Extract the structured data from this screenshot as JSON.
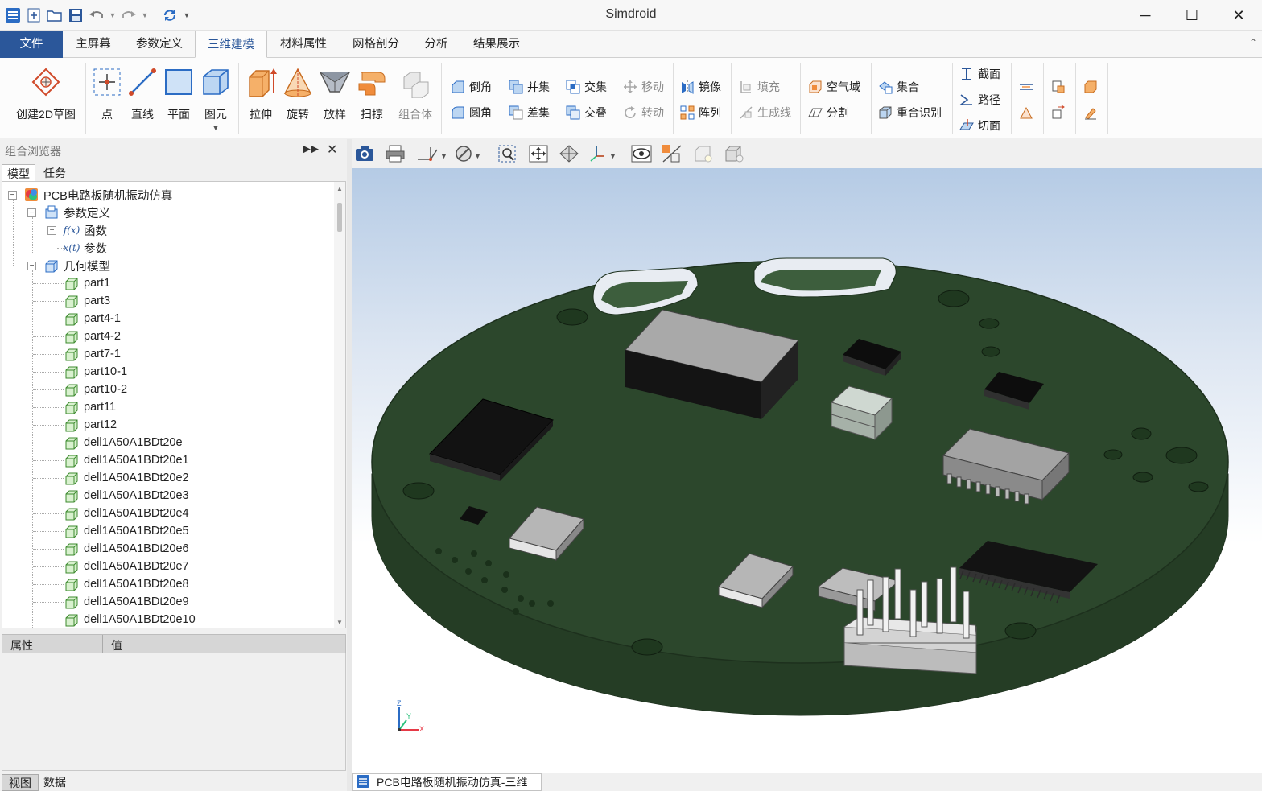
{
  "app": {
    "title": "Simdroid"
  },
  "window_controls": {
    "minimize": "─",
    "maximize": "☐",
    "close": "✕"
  },
  "ribbon_tabs": [
    "文件",
    "主屏幕",
    "参数定义",
    "三维建模",
    "材料属性",
    "网格剖分",
    "分析",
    "结果展示"
  ],
  "active_tab": "三维建模",
  "ribbon": {
    "sketch": "创建2D草图",
    "primitives": [
      "点",
      "直线",
      "平面",
      "图元"
    ],
    "features": [
      "拉伸",
      "旋转",
      "放样",
      "扫掠",
      "组合体"
    ],
    "disabled_features": [
      "组合体"
    ],
    "edit": {
      "chamfer": "倒角",
      "fillet": "圆角",
      "union": "并集",
      "subtract": "差集",
      "intersect": "交集",
      "overlap": "交叠",
      "move": "移动",
      "rotate": "转动",
      "mirror": "镜像",
      "array": "阵列",
      "fill": "填充",
      "generate_line": "生成线",
      "air_domain": "空气域",
      "split": "分割",
      "set": "集合",
      "overlap_detect": "重合识别",
      "section": "截面",
      "path": "路径",
      "cut_plane": "切面"
    },
    "disabled_edit": [
      "移动",
      "转动",
      "填充",
      "生成线"
    ]
  },
  "browser": {
    "title": "组合浏览器",
    "tabs": [
      "模型",
      "任务"
    ],
    "active_tab": "模型",
    "root": "PCB电路板随机振动仿真",
    "param_group": "参数定义",
    "param_children": [
      {
        "label": "函数",
        "icon": "function-icon"
      },
      {
        "label": "参数",
        "icon": "variable-icon"
      }
    ],
    "geom_group": "几何模型",
    "parts": [
      "part1",
      "part3",
      "part4-1",
      "part4-2",
      "part7-1",
      "part10-1",
      "part10-2",
      "part11",
      "part12",
      "dell1A50A1BDt20e",
      "dell1A50A1BDt20e1",
      "dell1A50A1BDt20e2",
      "dell1A50A1BDt20e3",
      "dell1A50A1BDt20e4",
      "dell1A50A1BDt20e5",
      "dell1A50A1BDt20e6",
      "dell1A50A1BDt20e7",
      "dell1A50A1BDt20e8",
      "dell1A50A1BDt20e9",
      "dell1A50A1BDt20e10"
    ]
  },
  "properties": {
    "col_property": "属性",
    "col_value": "值"
  },
  "bottom_tabs": [
    "视图",
    "数据"
  ],
  "bottom_active": "视图",
  "viewport": {
    "doc_tab": "PCB电路板随机振动仿真-三维",
    "axes": {
      "x": "X",
      "y": "Y",
      "z": "Z"
    },
    "toolbar_icons": [
      "camera-icon",
      "print-icon",
      "axis-view-icon",
      "no-section-icon",
      "zoom-box-icon",
      "pan-icon",
      "fit-all-icon",
      "coordinate-icon",
      "visibility-icon",
      "section-view-icon",
      "light-icon",
      "shade-icon"
    ]
  },
  "colors": {
    "accent": "#2b579a",
    "pcb_top": "#2e4a2e",
    "pcb_side": "#253f25",
    "bg_top": "#b5cbe5"
  }
}
